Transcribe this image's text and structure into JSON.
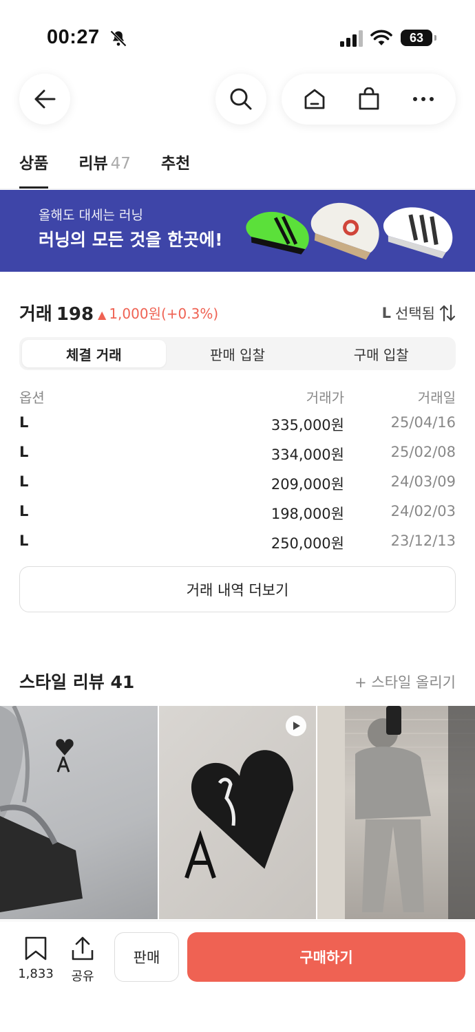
{
  "status_bar": {
    "time": "00:27",
    "battery": "63"
  },
  "header": {
    "icons": [
      "back-arrow-icon",
      "search-icon",
      "home-icon",
      "shopping-bag-icon",
      "more-icon"
    ]
  },
  "tabs": [
    {
      "label": "상품",
      "count": ""
    },
    {
      "label": "리뷰",
      "count": "47"
    },
    {
      "label": "추천",
      "count": ""
    }
  ],
  "banner": {
    "subtitle": "올해도 대세는 러닝",
    "title": "러닝의 모든 것을 한곳에!",
    "color": "#3e45a8"
  },
  "trade": {
    "title": "거래",
    "count": "198",
    "change": "1,000원(+0.3%)",
    "change_color": "#ef6253",
    "size_selected": "L",
    "size_suffix": "선택됨",
    "segments": [
      "체결 거래",
      "판매 입찰",
      "구매 입찰"
    ],
    "active_segment": 0,
    "columns": {
      "option": "옵션",
      "price": "거래가",
      "date": "거래일"
    },
    "rows": [
      {
        "option": "L",
        "price": "335,000원",
        "date": "25/04/16"
      },
      {
        "option": "L",
        "price": "334,000원",
        "date": "25/02/08"
      },
      {
        "option": "L",
        "price": "209,000원",
        "date": "24/03/09"
      },
      {
        "option": "L",
        "price": "198,000원",
        "date": "24/02/03"
      },
      {
        "option": "L",
        "price": "250,000원",
        "date": "23/12/13"
      }
    ],
    "more_label": "거래 내역 더보기"
  },
  "style_review": {
    "title": "스타일 리뷰",
    "count": "41",
    "add_label": "+ 스타일 올리기"
  },
  "bottom_bar": {
    "bookmark_count": "1,833",
    "share_label": "공유",
    "sell_label": "판매",
    "buy_label": "구매하기",
    "buy_color": "#ef6253"
  }
}
